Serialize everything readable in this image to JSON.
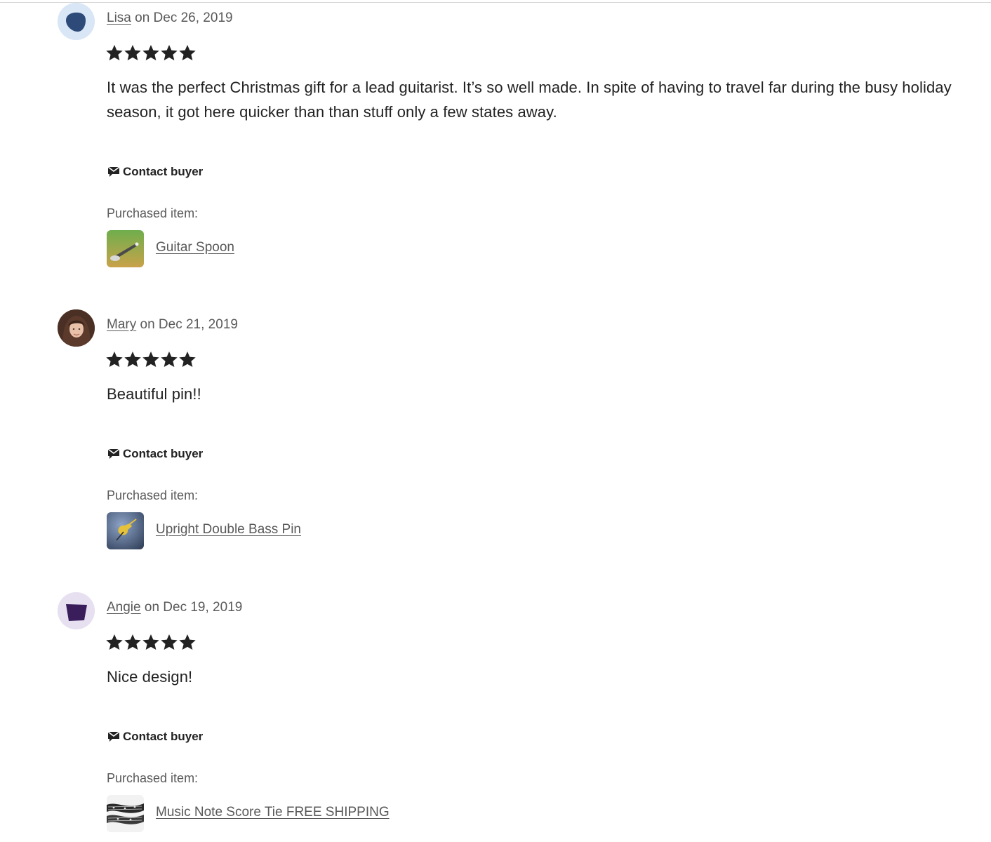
{
  "contact_label": "Contact buyer",
  "purchased_label": "Purchased item:",
  "star_color": "#222222",
  "reviews": [
    {
      "reviewer": "Lisa",
      "date_text": " on Dec 26, 2019",
      "rating": 5,
      "text": "It was the perfect Christmas gift for a lead guitarist. It’s so well made. In spite of having to travel far during the busy holiday season, it got here quicker than than stuff only a few states away.",
      "item": "Guitar Spoon",
      "avatar_icon": "guitar-pick-icon",
      "avatar_bg": "#d8e6f6",
      "avatar_fg": "#2e4a78"
    },
    {
      "reviewer": "Mary",
      "date_text": " on Dec 21, 2019",
      "rating": 5,
      "text": "Beautiful pin!!",
      "item": "Upright Double Bass Pin",
      "avatar_icon": "profile-photo",
      "avatar_bg": "#6b4a3a",
      "avatar_fg": "#e8c1a8"
    },
    {
      "reviewer": "Angie",
      "date_text": " on Dec 19, 2019",
      "rating": 5,
      "text": "Nice design!",
      "item": "Music Note Score Tie FREE SHIPPING",
      "avatar_icon": "purple-shape-icon",
      "avatar_bg": "#e7e0f1",
      "avatar_fg": "#3a1e5c"
    }
  ]
}
